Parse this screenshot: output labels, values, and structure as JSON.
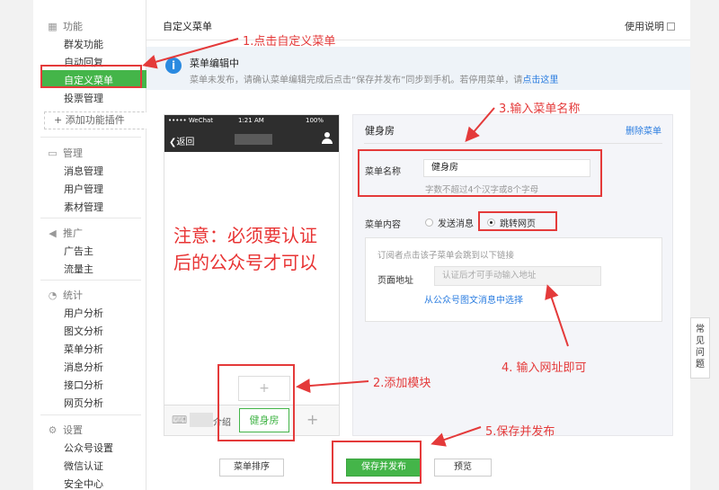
{
  "sidebar": {
    "groups": {
      "function": {
        "title": "功能",
        "items": [
          "群发功能",
          "自动回复",
          "自定义菜单",
          "投票管理"
        ],
        "add_plugin": "+ 添加功能插件"
      },
      "manage": {
        "title": "管理",
        "items": [
          "消息管理",
          "用户管理",
          "素材管理"
        ]
      },
      "promote": {
        "title": "推广",
        "items": [
          "广告主",
          "流量主"
        ]
      },
      "stats": {
        "title": "统计",
        "items": [
          "用户分析",
          "图文分析",
          "菜单分析",
          "消息分析",
          "接口分析",
          "网页分析"
        ]
      },
      "settings": {
        "title": "设置",
        "items": [
          "公众号设置",
          "微信认证",
          "安全中心"
        ]
      }
    }
  },
  "header": {
    "title": "自定义菜单",
    "help": "使用说明"
  },
  "notice": {
    "title": "菜单编辑中",
    "text": "菜单未发布，请确认菜单编辑完成后点击“保存并发布”同步到手机。若停用菜单，请",
    "link": "点击这里"
  },
  "phone": {
    "carrier": "••••• WeChat",
    "time": "1:21 AM",
    "battery": "100%",
    "back": "返回",
    "jie": "介绍",
    "active_menu": "健身房",
    "plus": "+",
    "sub_add": "+"
  },
  "editor": {
    "title": "健身房",
    "delete": "删除菜单",
    "name_label": "菜单名称",
    "name_value": "健身房",
    "name_hint": "字数不超过4个汉字或8个字母",
    "content_label": "菜单内容",
    "opt_message": "发送消息",
    "opt_webpage": "跳转网页",
    "url_desc": "订阅者点击该子菜单会跳到以下链接",
    "url_label": "页面地址",
    "url_placeholder": "认证后才可手动输入地址",
    "url_link": "从公众号图文消息中选择"
  },
  "buttons": {
    "sort": "菜单排序",
    "save": "保存并发布",
    "preview": "预览"
  },
  "faq": "常见问题",
  "annotations": {
    "step1": "1.点击自定义菜单",
    "step2": "2.添加模块",
    "step3": "3.输入菜单名称",
    "step4": "4. 输入网址即可",
    "step5": "5.保存并发布",
    "note_line1": "注意：必须要认证",
    "note_line2": "后的公众号才可以"
  },
  "colors": {
    "accent": "#44b549",
    "annotation": "#e43a3a",
    "link": "#2b7de0"
  }
}
